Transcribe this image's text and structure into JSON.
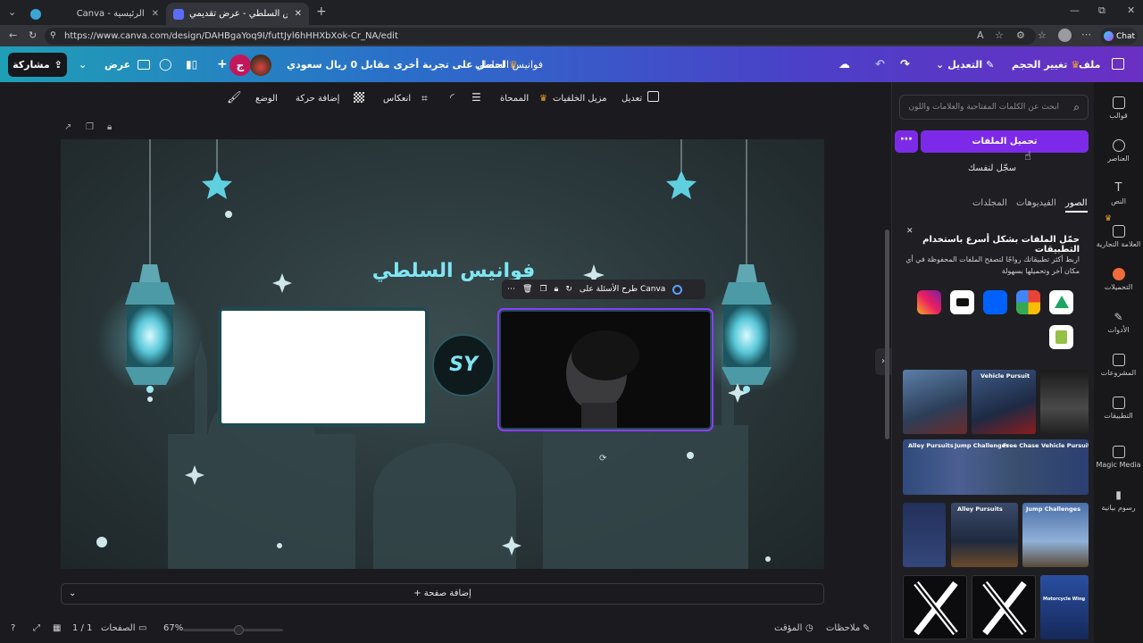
{
  "browser": {
    "tabs": [
      {
        "title": "Canva - الرئيسية",
        "active": false
      },
      {
        "title": "فوانيس السلطي - عرض تقديمي",
        "active": true
      }
    ],
    "url": "https://www.canva.com/design/DAHBgaYoq9I/futtJyl6hHHXbXok-Cr_NA/edit",
    "chat_label": "Chat"
  },
  "header": {
    "file": "ملف",
    "resize": "تغيير الحجم",
    "edit": "التعديل",
    "design_title": "فوانيس السلطي",
    "promo": "احصل على تجربة أخرى مقابل 0 ريال سعودي",
    "avatar_letter": "ج",
    "present": "عرض",
    "share": "مشاركة"
  },
  "toolbar": {
    "edit": "تعديل",
    "bg_remover": "مزيل الخلفيات",
    "eraser": "الممحاة",
    "flip": "انعكاس",
    "animate": "إضافة حركة",
    "position": "الوضع"
  },
  "canvas": {
    "title": "فوانيس السلطي",
    "logo_text": "SY",
    "ask_canva": "طرح الأسئلة على Canva"
  },
  "editor": {
    "add_page": "+ إضافة صفحة",
    "notes": "ملاحظات",
    "timer": "المؤقت",
    "pages": "الصفحات",
    "page_count": "1 / 1",
    "zoom": "67%"
  },
  "panel": {
    "search_placeholder": "ابحث عن الكلمات المفتاحية والعلامات واللون",
    "upload": "تحميل الملفات",
    "record": "سجّل لنفسك",
    "tabs": [
      "الصور",
      "الفيديوهات",
      "المجلدات"
    ],
    "promo_title": "حمّل الملفات بشكل أسرع باستخدام التطبيقات",
    "promo_desc": "اربط أكثر تطبيقاتك رواجًا لتصفح الملفات المحفوظة في أي مكان آخر وتحميلها بسهولة",
    "thumb_captions": [
      "Vehicle Pursuit",
      "Alley Pursuits",
      "Jump Challenges",
      "Free Chase",
      "Vehicle Pursuit",
      "Alley Pursuits",
      "Jump Challenges",
      "Motorcycle Wing"
    ]
  },
  "rail": [
    {
      "label": "قوالب"
    },
    {
      "label": "العناصر"
    },
    {
      "label": "النص"
    },
    {
      "label": "العلامة التجارية"
    },
    {
      "label": "التحميلات"
    },
    {
      "label": "الأدوات"
    },
    {
      "label": "المشروعات"
    },
    {
      "label": "التطبيقات"
    },
    {
      "label": "Magic Media"
    },
    {
      "label": "رسوم بيانية"
    }
  ],
  "colors": {
    "accent": "#7d2ae8",
    "header_start": "#1f9fb6",
    "header_end": "#6a2fc3",
    "glow": "#7fe6f3"
  }
}
